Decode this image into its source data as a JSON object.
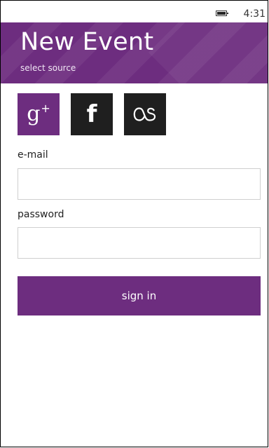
{
  "status_bar": {
    "time": "4:31"
  },
  "header": {
    "title": "New Event",
    "subtitle": "select source"
  },
  "sources": [
    {
      "name": "google-plus",
      "glyph": "g",
      "sup": "+",
      "color": "#6d2d7f"
    },
    {
      "name": "facebook",
      "glyph": "f",
      "color": "#1f1f1f"
    },
    {
      "name": "lastfm",
      "color": "#1f1f1f"
    }
  ],
  "form": {
    "email_label": "e-mail",
    "email_value": "",
    "password_label": "password",
    "password_value": "",
    "signin_label": "sign in"
  },
  "colors": {
    "accent": "#6d2d7f",
    "dark_tile": "#1f1f1f"
  }
}
